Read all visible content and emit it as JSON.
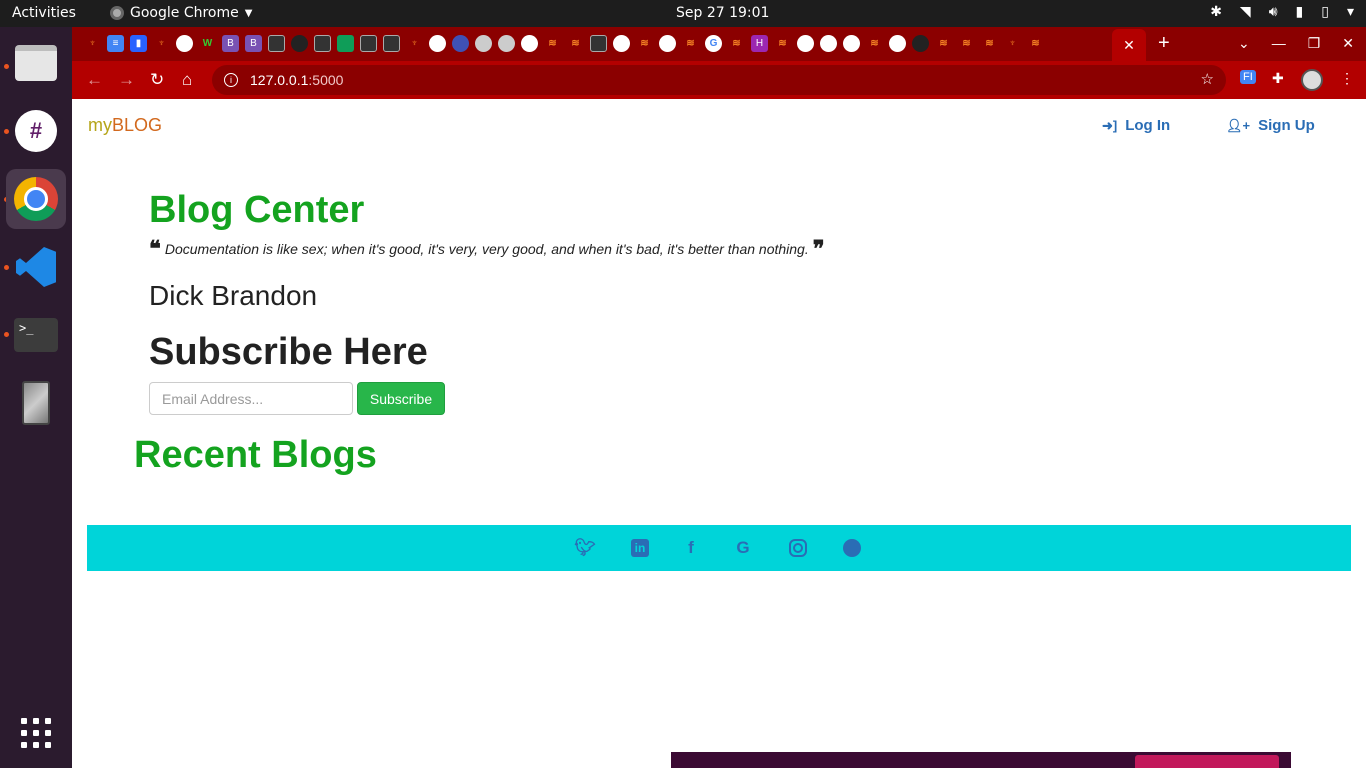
{
  "topbar": {
    "activities": "Activities",
    "app_name": "Google Chrome",
    "clock": "Sep 27  19:01"
  },
  "browser": {
    "url_host": "127.0.0.1",
    "url_port": ":5000",
    "theme_color": "#b30000"
  },
  "site": {
    "brand_prefix": "my",
    "brand_suffix": "BLOG",
    "nav": {
      "login": "Log In",
      "signup": "Sign Up"
    }
  },
  "main": {
    "title": "Blog Center",
    "quote": "Documentation is like sex; when it's good, it's very, very good, and when it's bad, it's better than nothing.",
    "author": "Dick Brandon",
    "subscribe_heading": "Subscribe Here",
    "email_placeholder": "Email Address...",
    "subscribe_button": "Subscribe",
    "recent_heading": "Recent Blogs"
  },
  "footer": {
    "color": "#00d4d9",
    "icons": [
      "twitter-icon",
      "linkedin-icon",
      "facebook-icon",
      "google-icon",
      "instagram-icon",
      "github-icon"
    ]
  },
  "colors": {
    "heading_green": "#14a31f",
    "link_blue": "#2a6db5",
    "button_green": "#28b64a"
  }
}
